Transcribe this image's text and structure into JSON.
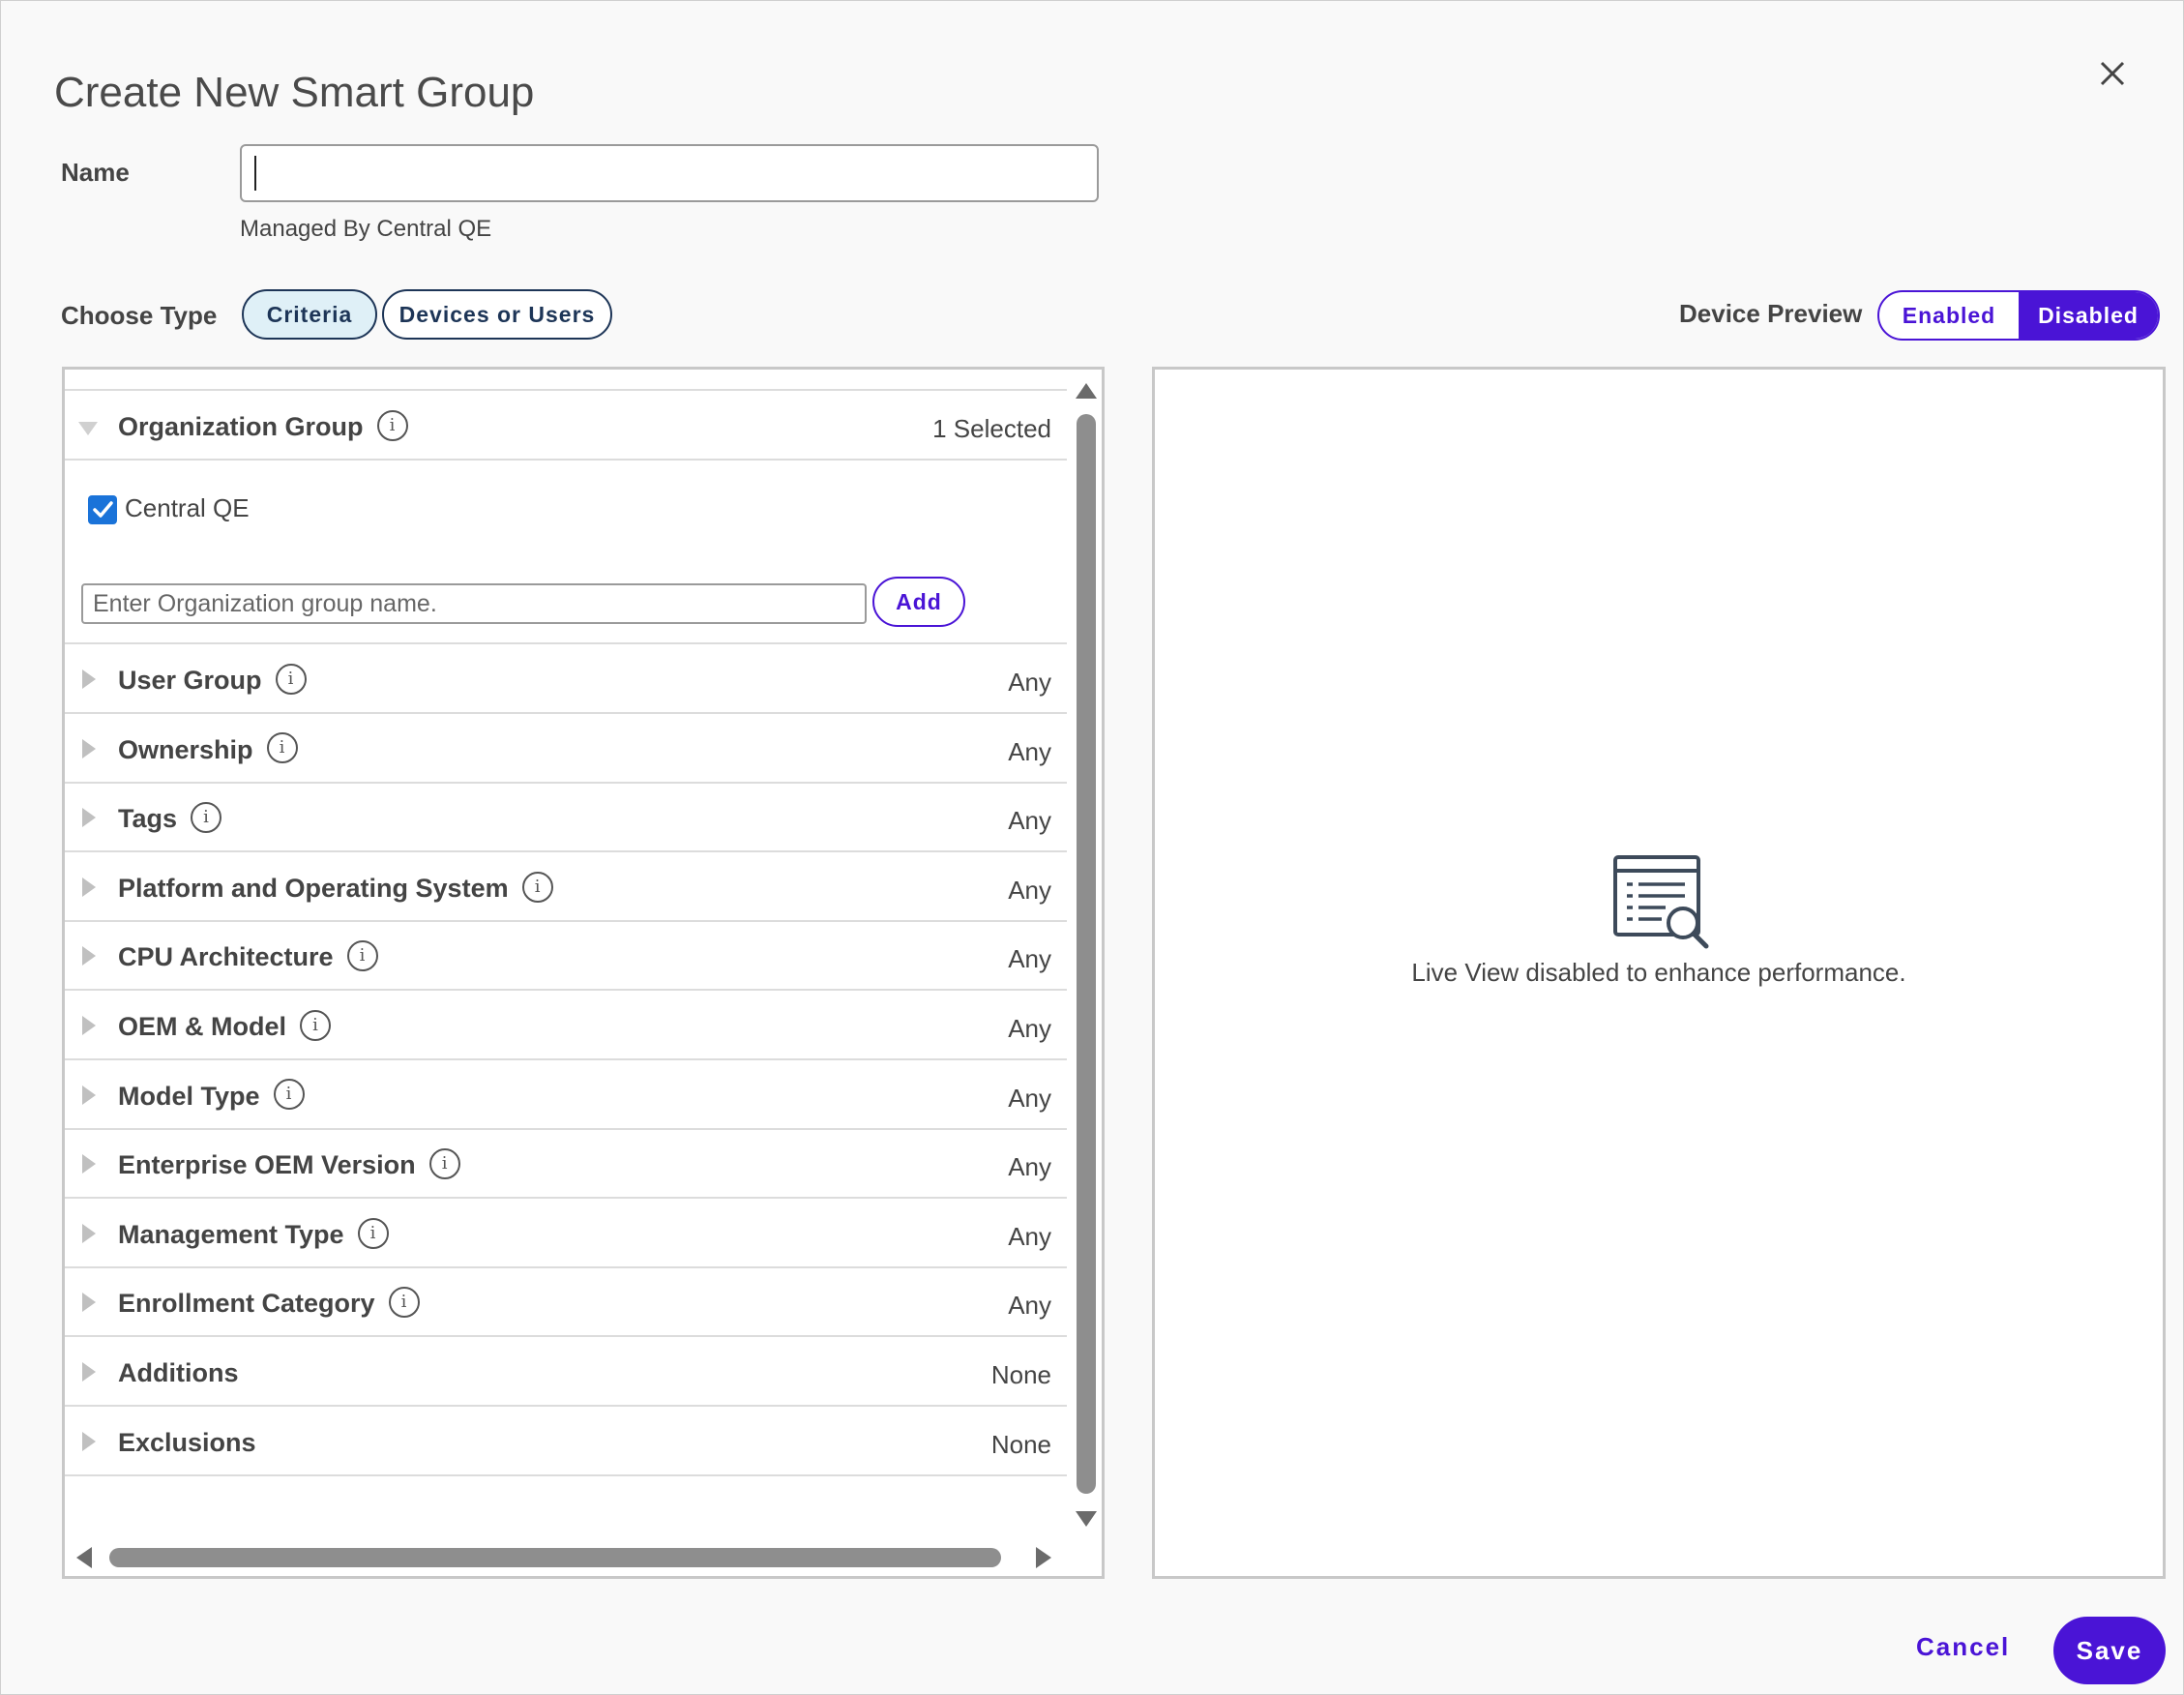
{
  "dialog": {
    "title": "Create New Smart Group"
  },
  "name_field": {
    "label": "Name",
    "value": "",
    "managed_by": "Managed By Central QE"
  },
  "choose_type": {
    "label": "Choose Type",
    "options": [
      "Criteria",
      "Devices or Users"
    ],
    "selected": "Criteria"
  },
  "device_preview": {
    "label": "Device Preview",
    "options": [
      "Enabled",
      "Disabled"
    ],
    "selected": "Disabled"
  },
  "criteria": {
    "organization_group": {
      "label": "Organization Group",
      "value": "1 Selected",
      "checked_item": "Central QE",
      "input_placeholder": "Enter Organization group name.",
      "add_label": "Add"
    },
    "rows": [
      {
        "label": "User Group",
        "value": "Any",
        "info": true
      },
      {
        "label": "Ownership",
        "value": "Any",
        "info": true
      },
      {
        "label": "Tags",
        "value": "Any",
        "info": true
      },
      {
        "label": "Platform and Operating System",
        "value": "Any",
        "info": true
      },
      {
        "label": "CPU Architecture",
        "value": "Any",
        "info": true
      },
      {
        "label": "OEM & Model",
        "value": "Any",
        "info": true
      },
      {
        "label": "Model Type",
        "value": "Any",
        "info": true
      },
      {
        "label": "Enterprise OEM Version",
        "value": "Any",
        "info": true
      },
      {
        "label": "Management Type",
        "value": "Any",
        "info": true
      },
      {
        "label": "Enrollment Category",
        "value": "Any",
        "info": true
      },
      {
        "label": "Additions",
        "value": "None",
        "info": false
      },
      {
        "label": "Exclusions",
        "value": "None",
        "info": false
      }
    ]
  },
  "preview_panel": {
    "icon": "report-search-icon",
    "message": "Live View disabled to enhance performance."
  },
  "footer": {
    "cancel_label": "Cancel",
    "save_label": "Save"
  },
  "colors": {
    "accent": "#4a14d6",
    "checkbox": "#1a73d9",
    "criteria_bg": "#dff0f7",
    "navy": "#1d3557"
  }
}
